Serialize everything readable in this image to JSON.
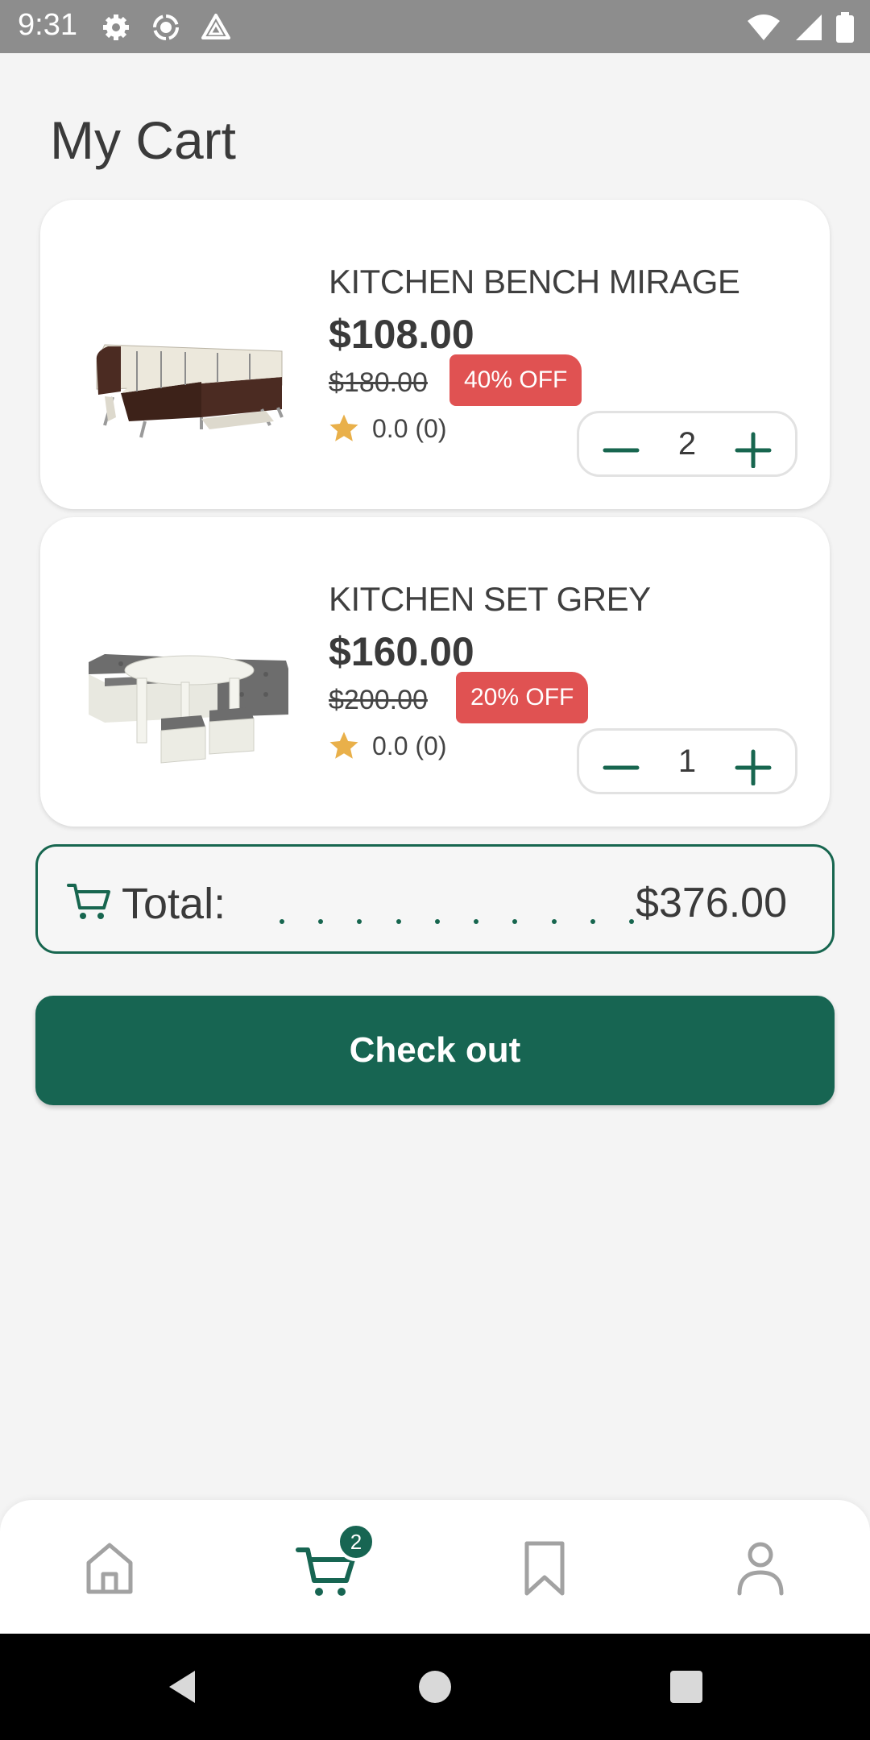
{
  "status_bar": {
    "time": "9:31",
    "icons": [
      "gear-icon",
      "circle-target-icon",
      "drive-triangle-icon"
    ],
    "right_icons": [
      "wifi-icon",
      "signal-icon",
      "battery-icon"
    ]
  },
  "page": {
    "title": "My Cart"
  },
  "cart": {
    "items": [
      {
        "name": "KITCHEN BENCH MIRAGE",
        "price": "$108.00",
        "old_price": "$180.00",
        "discount": "40% OFF",
        "rating": "0.0 (0)",
        "quantity": "2",
        "image_icon": "corner-bench-image"
      },
      {
        "name": "KITCHEN SET GREY",
        "price": "$160.00",
        "old_price": "$200.00",
        "discount": "20% OFF",
        "rating": "0.0 (0)",
        "quantity": "1",
        "image_icon": "kitchen-set-image"
      }
    ],
    "total_label": "Total:",
    "total_amount": "$376.00",
    "checkout_label": "Check out"
  },
  "bottom_nav": {
    "items": [
      "home-icon",
      "cart-icon",
      "bookmark-icon",
      "profile-icon"
    ],
    "active": "cart-icon",
    "cart_badge": "2"
  },
  "colors": {
    "accent": "#176552",
    "discount": "#e05252",
    "star": "#e9b04a"
  }
}
